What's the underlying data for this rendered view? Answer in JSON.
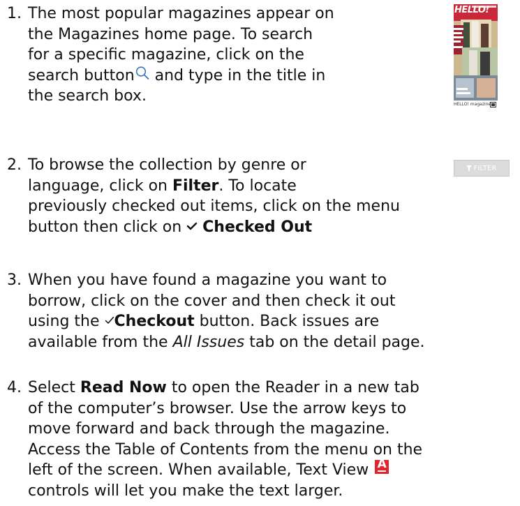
{
  "items": [
    {
      "number": "1.",
      "lines": [
        "The most popular magazines appear on",
        "the Magazines home page.  To search",
        "for a specific magazine, click on the"
      ],
      "line4_a": "search button",
      "line4_b": " and type in the title in",
      "line5": "the search box."
    },
    {
      "number": "2.",
      "line1": "To browse the collection by genre or",
      "line2_a": "language, click on ",
      "line2_b": "Filter",
      "line2_c": ". To locate",
      "line3": "previously checked out items, click on the menu",
      "line4_a": "button then click on ",
      "line4_b": "Checked Out"
    },
    {
      "number": "3.",
      "line1": "When you have found a magazine you want to",
      "line2": "borrow, click on the cover and then check it out",
      "line3_a": "using the ",
      "line3_b": "Checkout",
      "line3_c": " button. Back issues are",
      "line4_a": "available from the ",
      "line4_b": "All Issues",
      "line4_c": " tab on the detail page."
    },
    {
      "number": "4.",
      "line1_a": "Select ",
      "line1_b": "Read Now",
      "line1_c": " to open the Reader in a new tab",
      "line2": "of the computer’s browser. Use the arrow keys to",
      "line3": "move forward and back through the magazine.",
      "line4": "Access the Table of Contents from the menu on the",
      "line5": "left of the screen. When available, Text View",
      "line6": "controls will let you make the text larger."
    }
  ],
  "cover": {
    "masthead": "HELLO!",
    "caption": "HELLO! magazine",
    "icon": "device-icon"
  },
  "filter_button": {
    "label": "FILTER",
    "icon": "filter-funnel-icon",
    "background": "#dcdcdc"
  },
  "inline_icons": {
    "search": "search-icon",
    "check": "check-icon",
    "textview": "text-view-icon",
    "textview_letter": "A",
    "textview_color": "#e2252d"
  }
}
